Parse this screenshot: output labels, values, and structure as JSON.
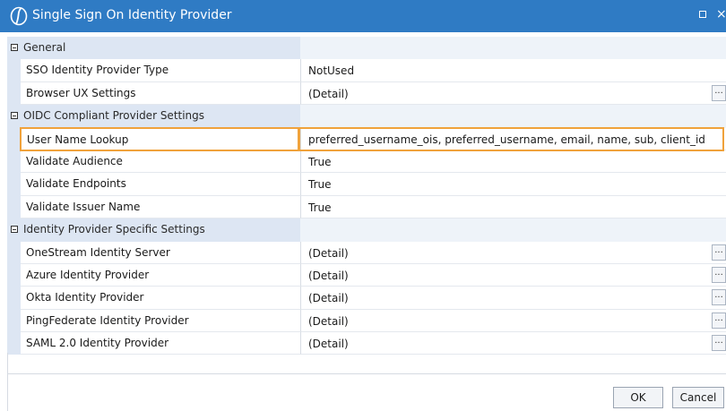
{
  "window": {
    "title": "Single Sign On Identity Provider",
    "close_glyph": "×"
  },
  "groups": [
    {
      "label": "General",
      "properties": [
        {
          "name": "SSO Identity Provider Type",
          "value": "NotUsed",
          "has_detail_button": false
        },
        {
          "name": "Browser UX Settings",
          "value": "(Detail)",
          "has_detail_button": true
        }
      ]
    },
    {
      "label": "OIDC Compliant Provider Settings",
      "properties": [
        {
          "name": "User Name Lookup",
          "value": "preferred_username_ois, preferred_username, email, name, sub, client_id",
          "has_detail_button": false,
          "selected": true
        },
        {
          "name": "Validate Audience",
          "value": "True",
          "has_detail_button": false
        },
        {
          "name": "Validate Endpoints",
          "value": "True",
          "has_detail_button": false
        },
        {
          "name": "Validate Issuer Name",
          "value": "True",
          "has_detail_button": false
        }
      ]
    },
    {
      "label": "Identity Provider Specific Settings",
      "properties": [
        {
          "name": "OneStream Identity Server",
          "value": "(Detail)",
          "has_detail_button": true
        },
        {
          "name": "Azure Identity Provider",
          "value": "(Detail)",
          "has_detail_button": true
        },
        {
          "name": "Okta Identity Provider",
          "value": "(Detail)",
          "has_detail_button": true
        },
        {
          "name": "PingFederate Identity Provider",
          "value": "(Detail)",
          "has_detail_button": true
        },
        {
          "name": "SAML 2.0 Identity Provider",
          "value": "(Detail)",
          "has_detail_button": true
        }
      ]
    }
  ],
  "detail_button_label": "...",
  "buttons": {
    "ok": "OK",
    "cancel": "Cancel"
  },
  "colors": {
    "titlebar": "#2f7bc4",
    "category_bg": "#dde6f3",
    "highlight": "#f0a23b"
  },
  "icons": {
    "app_logo": "onestream-logo-icon",
    "maximize": "maximize-icon",
    "close": "close-icon",
    "collapse": "collapse-icon"
  }
}
